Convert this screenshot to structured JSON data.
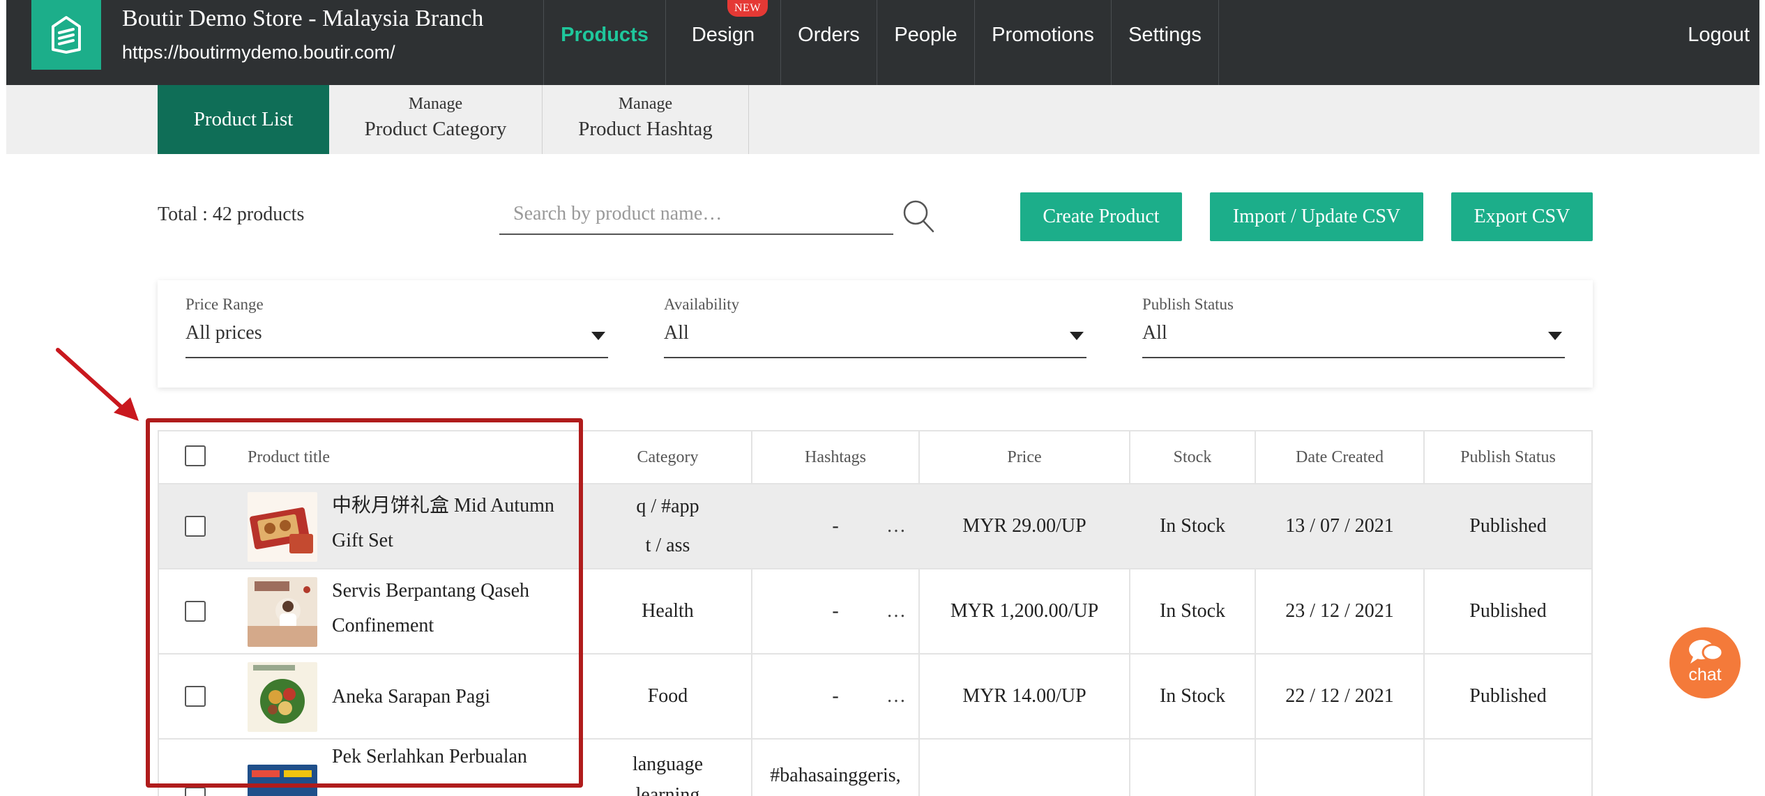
{
  "header": {
    "store_name": "Boutir Demo Store - Malaysia Branch",
    "store_url": "https://boutirmydemo.boutir.com/",
    "nav": [
      {
        "label": "Products",
        "active": true
      },
      {
        "label": "Design",
        "badge": "NEW"
      },
      {
        "label": "Orders"
      },
      {
        "label": "People"
      },
      {
        "label": "Promotions"
      },
      {
        "label": "Settings"
      }
    ],
    "logout": "Logout"
  },
  "subnav": {
    "product_list": "Product List",
    "category_small": "Manage",
    "category_big": "Product Category",
    "hashtag_small": "Manage",
    "hashtag_big": "Product Hashtag"
  },
  "toolbar": {
    "total": "Total : 42 products",
    "search_placeholder": "Search by product name…",
    "create": "Create Product",
    "import": "Import / Update CSV",
    "export": "Export CSV"
  },
  "filters": {
    "price_label": "Price Range",
    "price_value": "All prices",
    "availability_label": "Availability",
    "availability_value": "All",
    "publish_label": "Publish Status",
    "publish_value": "All"
  },
  "table": {
    "headers": {
      "title": "Product title",
      "category": "Category",
      "hashtags": "Hashtags",
      "price": "Price",
      "stock": "Stock",
      "date": "Date Created",
      "status": "Publish Status"
    },
    "rows": [
      {
        "title_line1": "中秋月饼礼盒 Mid Autumn",
        "title_line2": "Gift Set",
        "category_line1": "q / #app",
        "category_line2": "t / ass",
        "hashtag": "-",
        "more": "…",
        "price": "MYR 29.00/UP",
        "stock": "In Stock",
        "date": "13 / 07 / 2021",
        "status": "Published"
      },
      {
        "title_line1": "Servis Berpantang Qaseh",
        "title_line2": "Confinement",
        "category": "Health",
        "hashtag": "-",
        "more": "…",
        "price": "MYR 1,200.00/UP",
        "stock": "In Stock",
        "date": "23 / 12 / 2021",
        "status": "Published"
      },
      {
        "title": "Aneka Sarapan Pagi",
        "category": "Food",
        "hashtag": "-",
        "more": "…",
        "price": "MYR 14.00/UP",
        "stock": "In Stock",
        "date": "22 / 12 / 2021",
        "status": "Published"
      },
      {
        "title_line1": "Pek Serlahkan Perbualan",
        "category_line1": "language",
        "category_line2": "learning",
        "hashtag": "#bahasainggeris,"
      }
    ]
  },
  "chat": {
    "label": "chat"
  },
  "colors": {
    "accent": "#1cae8a",
    "dark": "#2e3133",
    "active_nav": "#1fc79c",
    "annotation": "#b01c1c",
    "chat": "#f47a3a"
  }
}
